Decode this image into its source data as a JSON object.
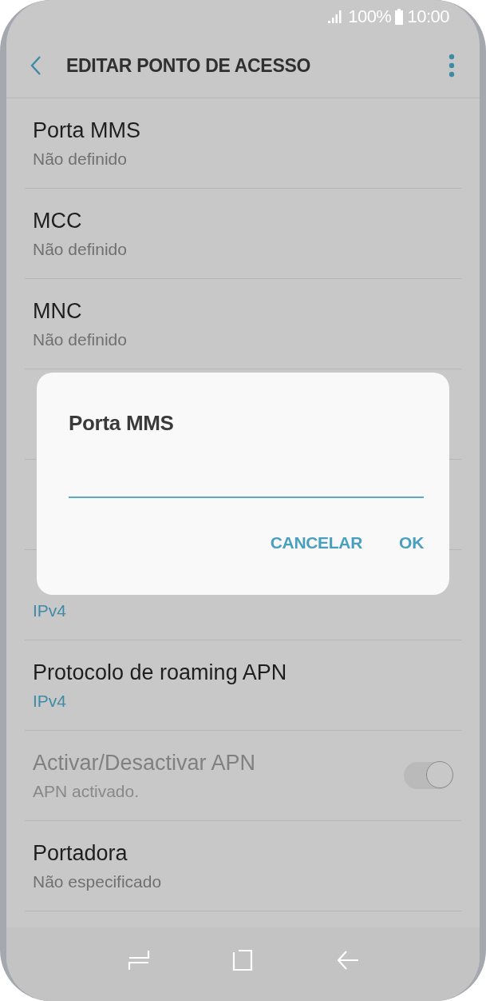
{
  "status_bar": {
    "battery": "100%",
    "time": "10:00"
  },
  "header": {
    "title": "EDITAR PONTO DE ACESSO"
  },
  "settings": [
    {
      "kind": "setting",
      "title": "Porta MMS",
      "subtitle": "Não definido"
    },
    {
      "kind": "setting",
      "title": "MCC",
      "subtitle": "Não definido"
    },
    {
      "kind": "setting",
      "title": "MNC",
      "subtitle": "Não definido"
    },
    {
      "kind": "covered"
    },
    {
      "kind": "covered"
    },
    {
      "kind": "choice",
      "subtitle": "IPv4"
    },
    {
      "kind": "choice",
      "title": "Protocolo de roaming APN",
      "subtitle": "IPv4"
    },
    {
      "kind": "toggle",
      "title": "Activar/Desactivar APN",
      "subtitle": "APN activado.",
      "on": true,
      "disabled": true
    },
    {
      "kind": "setting",
      "title": "Portadora",
      "subtitle": "Não especificado"
    }
  ],
  "dialog": {
    "title": "Porta MMS",
    "buttons": [
      "CANCELAR",
      "OK"
    ]
  }
}
